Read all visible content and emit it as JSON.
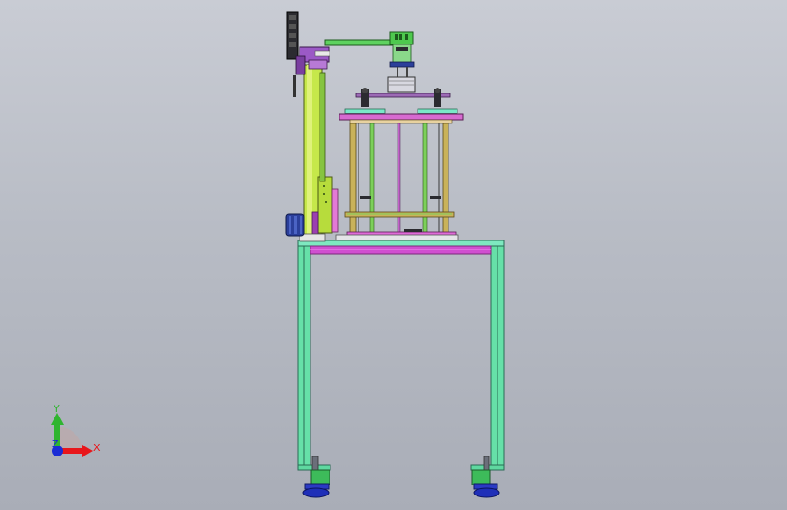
{
  "viewport": {
    "background_top": "#c9ccd4",
    "background_bottom": "#a9adb7"
  },
  "triad": {
    "x_label": "X",
    "y_label": "Y",
    "z_label": "Z",
    "x_color": "#e8161b",
    "y_color": "#2fb52f",
    "z_color": "#1a2cd6"
  },
  "palette": {
    "frame_leg": "#66e0a8",
    "table_top": "#d04fd0",
    "column_green": "#c6e84a",
    "cage_gold": "#c9b25a",
    "motor_blue": "#2b3f9a",
    "cylinder_green": "#4ec94e",
    "foot_blue": "#1f2fb8"
  }
}
